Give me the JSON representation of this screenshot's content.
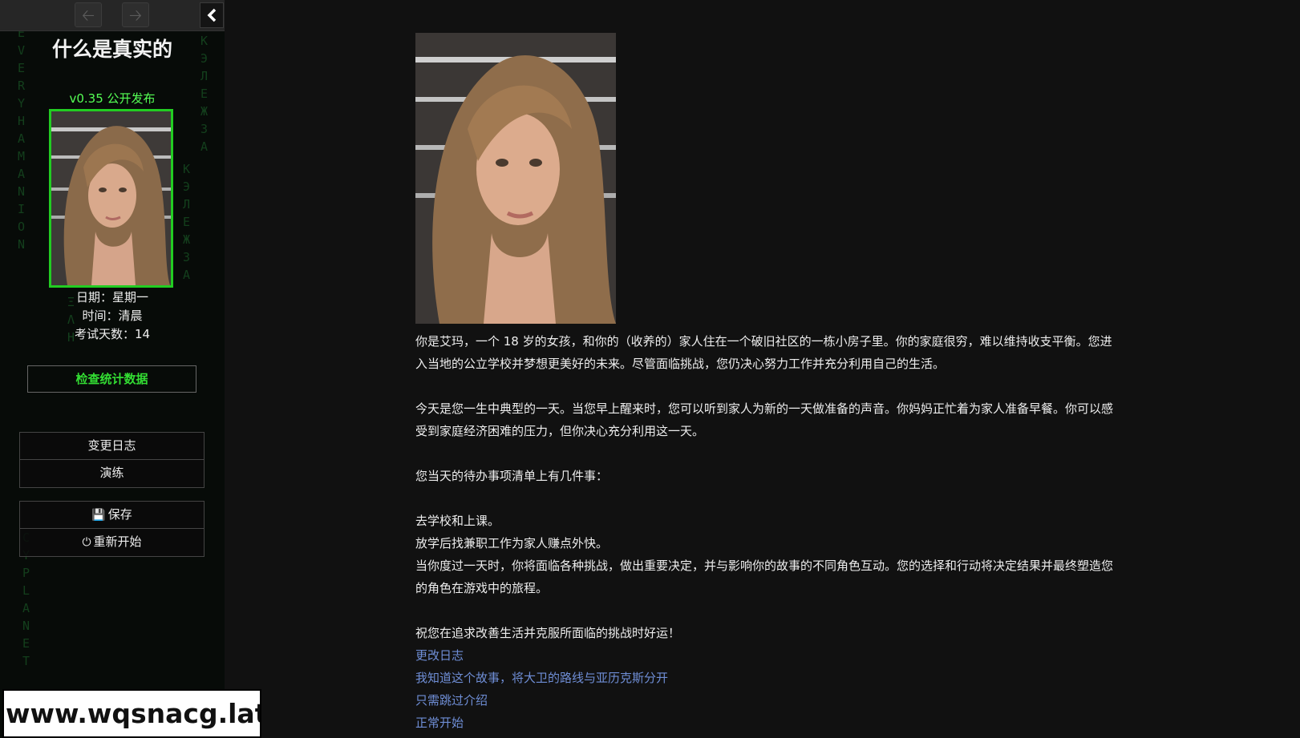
{
  "sidebar": {
    "nav": {
      "back_icon": "arrow-left-icon",
      "forward_icon": "arrow-right-icon",
      "toggle_icon": "chevron-left-icon"
    },
    "story_title": "什么是真实的",
    "version": "v0.35 公开发布",
    "date_label": "日期：星期一",
    "time_label": "时间：清晨",
    "exam_days_label": "考试天数：14",
    "stats_button": "检查统计数据",
    "menu": {
      "changelog": "变更日志",
      "practice": "演练",
      "save": "保存",
      "restart": "重新开始"
    },
    "matrix_text": [
      "EVERYHAMANION",
      "CYPLANET",
      "ΞΗ∞ΞΛΗ",
      "КЭЛЕЖЗА"
    ]
  },
  "story": {
    "paragraphs": [
      "你是艾玛，一个 18 岁的女孩，和你的（收养的）家人住在一个破旧社区的一栋小房子里。你的家庭很穷，难以维持收支平衡。您进入当地的公立学校并梦想更美好的未来。尽管面临挑战，您仍决心努力工作并充分利用自己的生活。",
      "今天是您一生中典型的一天。当您早上醒来时，您可以听到家人为新的一天做准备的声音。你妈妈正忙着为家人准备早餐。你可以感受到家庭经济困难的压力，但你决心充分利用这一天。",
      "您当天的待办事项清单上有几件事：",
      "去学校和上课。",
      "放学后找兼职工作为家人赚点外快。",
      "当你度过一天时，你将面临各种挑战，做出重要决定，并与影响你的故事的不同角色互动。您的选择和行动将决定结果并最终塑造您的角色在游戏中的旅程。",
      "祝您在追求改善生活并克服所面临的挑战时好运！"
    ],
    "links": [
      "更改日志",
      "我知道这个故事，将大卫的路线与亚历克斯分开",
      "只需跳过介绍",
      "正常开始"
    ]
  },
  "watermark": "www.wqsnacg.lat",
  "colors": {
    "accent_green": "#33dd33",
    "link_blue": "#6f8ed6",
    "background": "#111111"
  }
}
